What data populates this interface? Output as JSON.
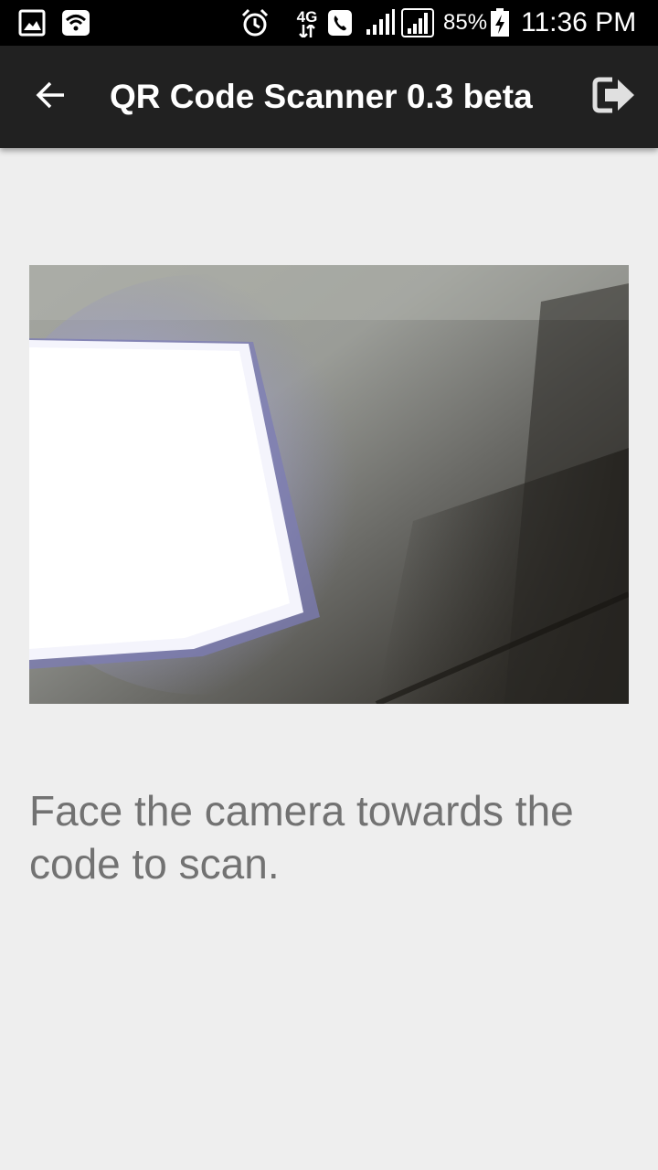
{
  "status_bar": {
    "battery_percent": "85%",
    "time": "11:36 PM",
    "network_type": "4G",
    "icons": [
      "gallery-notification-icon",
      "wifi-icon",
      "alarm-icon",
      "4g-data-icon",
      "call-icon",
      "signal-icon-sim1",
      "signal-icon-sim2",
      "battery-charging-icon"
    ]
  },
  "app_bar": {
    "title": "QR Code Scanner 0.3 beta",
    "back_icon": "arrow-back-icon",
    "exit_icon": "exit-app-icon"
  },
  "camera": {
    "description_icon": "camera-preview"
  },
  "instruction": {
    "text": "Face the camera towards the code to scan."
  },
  "colors": {
    "status_bar_bg": "#000000",
    "app_bar_bg": "#212121",
    "page_bg": "#eeeeee",
    "instruction_text": "#727272",
    "title_text": "#ffffff"
  }
}
